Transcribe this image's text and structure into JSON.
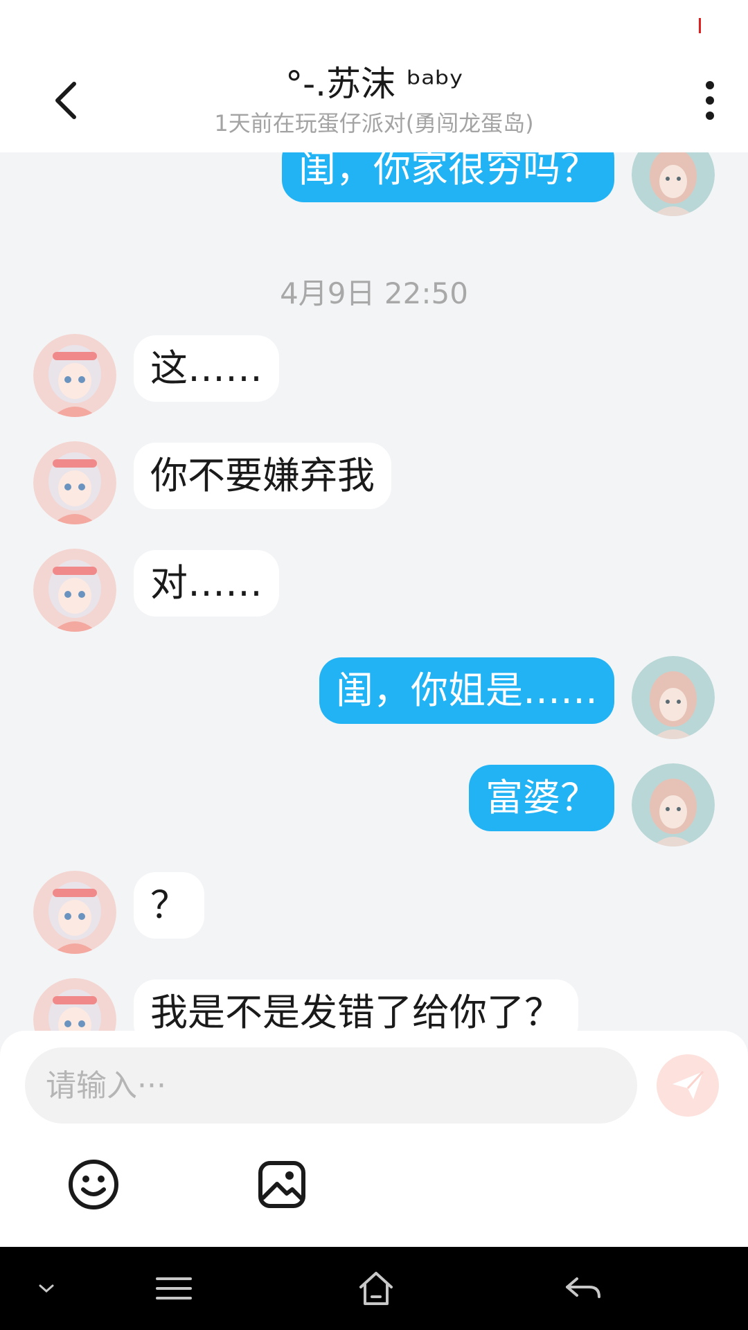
{
  "header": {
    "title": "°-.苏沫 ᵇᵃᵇʸ",
    "subtitle": "1天前在玩蛋仔派对(勇闯龙蛋岛)"
  },
  "chat": {
    "messages": [
      {
        "side": "out",
        "text": "闺，你家很穷吗？"
      },
      {
        "side": "in",
        "text": "这……"
      },
      {
        "side": "in",
        "text": "你不要嫌弃我"
      },
      {
        "side": "in",
        "text": "对……"
      },
      {
        "side": "out",
        "text": "闺，你姐是……"
      },
      {
        "side": "out",
        "text": "富婆？"
      },
      {
        "side": "in",
        "text": "？"
      },
      {
        "side": "in",
        "text": "我是不是发错了给你了？"
      }
    ],
    "timestamp": "4月9日 22:50"
  },
  "composer": {
    "placeholder": "请输入···"
  },
  "colors": {
    "outgoing_bubble": "#22b3f5",
    "incoming_bubble": "#ffffff",
    "chat_background": "#f3f4f6",
    "send_button": "#fde1dd"
  },
  "icons": {
    "back": "chevron-left-icon",
    "more": "more-vertical-icon",
    "send": "paper-plane-icon",
    "emoji": "smiley-icon",
    "image": "image-icon",
    "nav": [
      "chevron-down-icon",
      "menu-icon",
      "home-icon",
      "back-arrow-icon"
    ]
  }
}
